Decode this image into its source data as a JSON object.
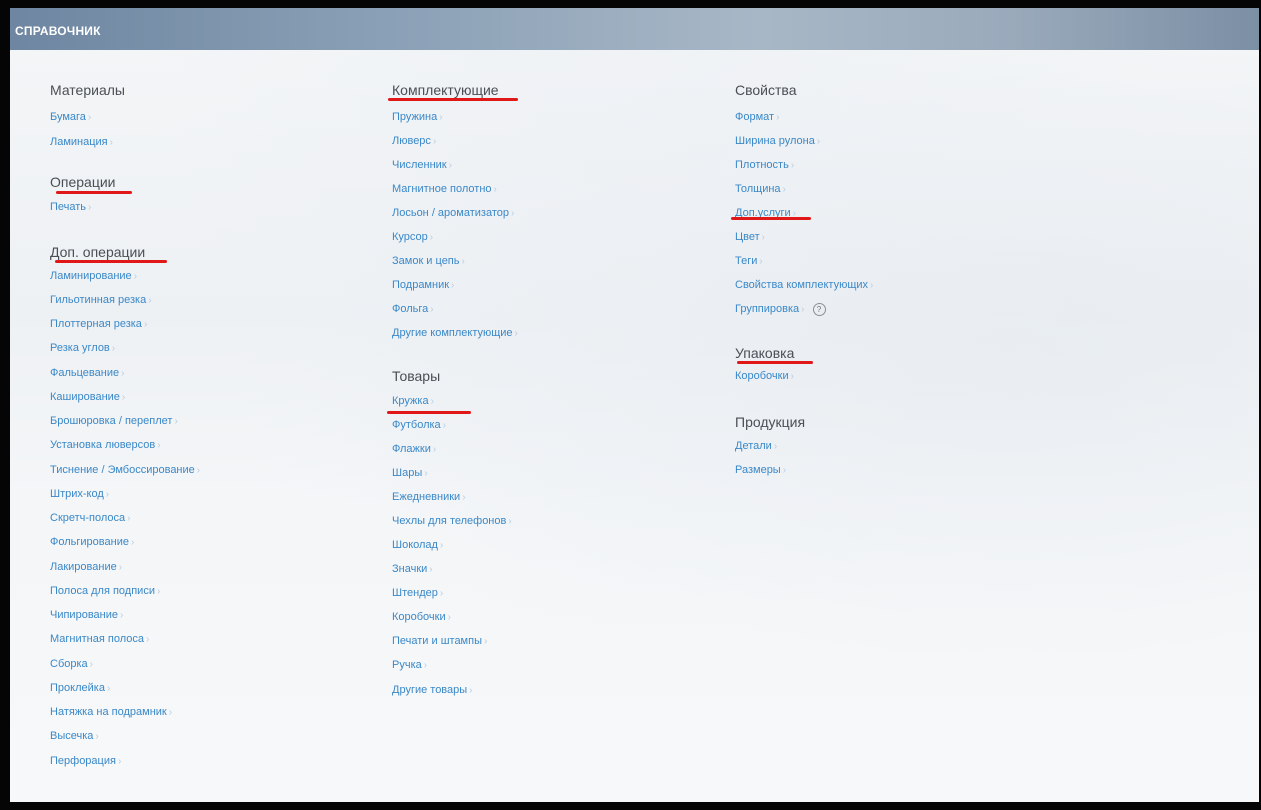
{
  "header": {
    "title": "СПРАВОЧНИК"
  },
  "columns": [
    {
      "sections": [
        {
          "title": "Материалы",
          "items": [
            "Бумага",
            "Ламинация"
          ]
        },
        {
          "title": "Операции",
          "items": [
            "Печать"
          ]
        },
        {
          "title": "Доп. операции",
          "items": [
            "Ламинирование",
            "Гильотинная резка",
            "Плоттерная резка",
            "Резка углов",
            "Фальцевание",
            "Каширование",
            "Брошюровка / переплет",
            "Установка люверсов",
            "Тиснение / Эмбоссирование",
            "Штрих-код",
            "Скретч-полоса",
            "Фольгирование",
            "Лакирование",
            "Полоса для подписи",
            "Чипирование",
            "Магнитная полоса",
            "Сборка",
            "Проклейка",
            "Натяжка на подрамник",
            "Высечка",
            "Перфорация"
          ]
        }
      ]
    },
    {
      "sections": [
        {
          "title": "Комплектующие",
          "items": [
            "Пружина",
            "Люверс",
            "Численник",
            "Магнитное полотно",
            "Лосьон / ароматизатор",
            "Курсор",
            "Замок и цепь",
            "Подрамник",
            "Фольга",
            "Другие комплектующие"
          ]
        },
        {
          "title": "Товары",
          "items": [
            "Кружка",
            "Футболка",
            "Флажки",
            "Шары",
            "Ежедневники",
            "Чехлы для телефонов",
            "Шоколад",
            "Значки",
            "Штендер",
            "Коробочки",
            "Печати и штампы",
            "Ручка",
            "Другие товары"
          ]
        }
      ]
    },
    {
      "sections": [
        {
          "title": "Свойства",
          "items": [
            "Формат",
            "Ширина рулона",
            "Плотность",
            "Толщина",
            "Доп.услуги",
            "Цвет",
            "Теги",
            "Свойства комплектующих",
            "Группировка"
          ]
        },
        {
          "title": "Упаковка",
          "items": [
            "Коробочки"
          ]
        },
        {
          "title": "Продукция",
          "items": [
            "Детали",
            "Размеры"
          ]
        }
      ]
    }
  ],
  "chevron": "›",
  "help_icon": {
    "glyph": "?",
    "name": "help-icon"
  },
  "annotation_color": "#e01818"
}
